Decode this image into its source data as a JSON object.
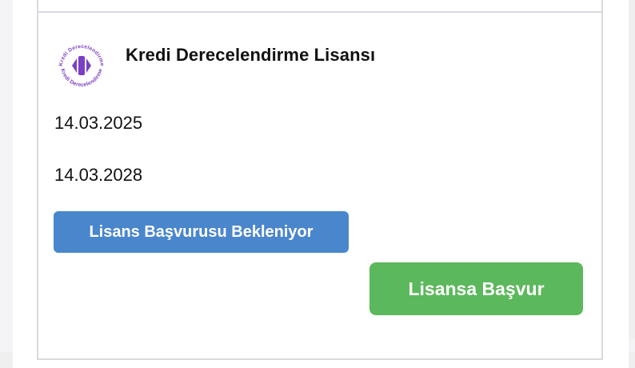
{
  "license": {
    "title": "Kredi Derecelendirme Lisansı",
    "logo_text_top": "Kredi Derecelendirme",
    "logo_text_bottom": "Kredi Derecelendirme",
    "start_date": "14.03.2025",
    "end_date": "14.03.2028",
    "status_label": "Lisans Başvurusu Bekleniyor",
    "apply_label": "Lisansa Başvur"
  },
  "colors": {
    "status_blue": "#4a86cc",
    "apply_green": "#5cb85c",
    "logo_purple": "#7b3fc4"
  },
  "icons": {
    "logo": "kredi-derecelendirme-logo"
  }
}
